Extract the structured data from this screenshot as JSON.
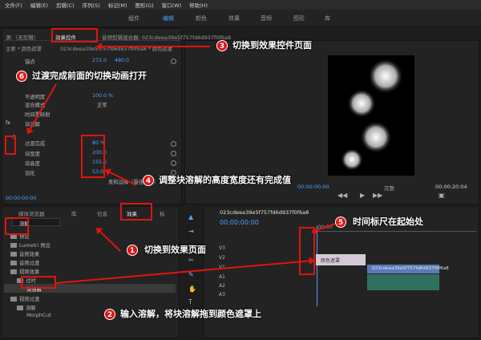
{
  "menu": [
    "文件(F)",
    "编辑(E)",
    "剪辑(C)",
    "序列(S)",
    "标记(M)",
    "图形(G)",
    "窗口(W)",
    "帮助(H)"
  ],
  "workspaces": [
    "组件",
    "编辑",
    "颜色",
    "效果",
    "音频",
    "图形",
    "库"
  ],
  "source_tab": "源:（无剪辑）",
  "effect_controls_tab": "效果控件",
  "audio_mixer_tab": "音频剪辑混合器: 023cdeea39e5f757fd6d937f0f6a8",
  "clip_header": "主要 * 颜色遮罩",
  "clip_header_seq": "023cdeea39e5f757fd6d937f0f6a8 * 颜色遮罩",
  "anchor_label": "锚点",
  "anchor_x": "272.0",
  "anchor_y": "480.0",
  "opacity_label": "不透明度",
  "opacity_value": "100.0 %",
  "blend_label": "混合模式",
  "blend_value": "正常",
  "time_remap_label": "时间重映射",
  "effect_name": "块溶解",
  "transition_label": "过渡完成",
  "transition_value": "80 %",
  "block_width_label": "块宽度",
  "block_width_value": "200.0",
  "block_height_label": "块高度",
  "block_height_value": "155.0",
  "feather_label": "羽化",
  "feather_value": "53.0",
  "soft_edges_label": "柔和边缘（最佳品质）",
  "ec_timecode": "00:00:00:00",
  "program_timecode_left": "00:00:00:00",
  "program_fit": "完整",
  "program_timecode_right": "00:00:20:04",
  "project_tabs": [
    "媒体浏览器",
    "库",
    "信息",
    "效果",
    "标"
  ],
  "search_value": "溶解",
  "effects_tree": [
    "预设",
    "Lumetri 预设",
    "音频效果",
    "音频过渡",
    "视频效果",
    "过时",
    "块溶解",
    "视频过渡",
    "溶解",
    "MorphCut"
  ],
  "timeline_tab": "023cdeea39e5f757fd6d937f0f6a8",
  "timeline_timecode": "00:00:00:00",
  "timeline_ruler_start": ":00:00",
  "tracks": [
    "V3",
    "V2",
    "V1",
    "A1",
    "A2",
    "A3"
  ],
  "clip_mask_label": "颜色遮罩",
  "clip_video_label": "023cdeea39e5f757fd6d937f0f6a8",
  "annotations": {
    "n1": "1",
    "t1": "切换到效果页面",
    "n2": "2",
    "t2": "输入溶解，将块溶解拖到颜色遮罩上",
    "n3": "3",
    "t3": "切换到效果控件页面",
    "n4": "4",
    "t4": "调整块溶解的高度宽度还有完成值",
    "n5": "5",
    "t5": "时间标尺在起始处",
    "n6": "6",
    "t6": "过渡完成前面的切换动画打开"
  },
  "colors": {
    "accent": "#4aa3ff",
    "annotation_red": "#e0140e",
    "clip_mask": "#d6c9d6",
    "clip_video": "#5a7ab8"
  }
}
